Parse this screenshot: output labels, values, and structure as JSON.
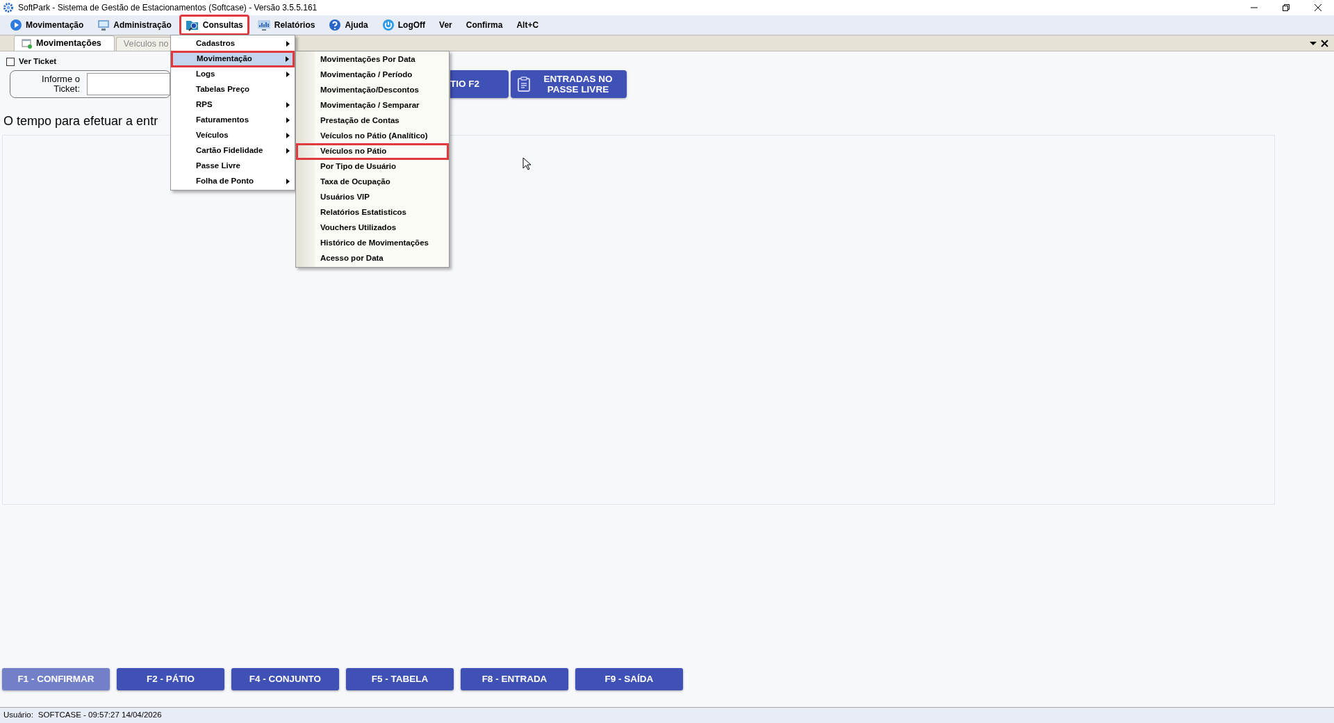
{
  "window": {
    "title": "SoftPark - Sistema de Gestão de Estacionamentos (Softcase) - Versão 3.5.5.161"
  },
  "menu_bar": [
    {
      "label": "Movimentação",
      "open": false,
      "annotated": false
    },
    {
      "label": "Administração",
      "open": false,
      "annotated": false
    },
    {
      "label": "Consultas",
      "open": true,
      "annotated": true
    },
    {
      "label": "Relatórios",
      "open": false,
      "annotated": false
    },
    {
      "label": "Ajuda",
      "open": false,
      "annotated": false
    },
    {
      "label": "LogOff",
      "open": false,
      "annotated": false
    },
    {
      "label": "Ver",
      "open": false,
      "annotated": false
    },
    {
      "label": "Confirma",
      "open": false,
      "annotated": false
    },
    {
      "label": "Alt+C",
      "open": false,
      "annotated": false
    }
  ],
  "tabs": [
    {
      "label": "Movimentações",
      "selected": true
    },
    {
      "label": "Veículos no",
      "selected": false
    }
  ],
  "ver_ticket": {
    "label": "Ver Ticket",
    "checked": false
  },
  "ticket_label": "Informe o Ticket:",
  "top_buttons": [
    {
      "label": "TIO F2",
      "kind": "plain"
    },
    {
      "label": "ENTRADAS NO PASSE LIVRE",
      "kind": "icon"
    }
  ],
  "message": "O tempo para efetuar a entr",
  "function_buttons": [
    {
      "label": "F1 - CONFIRMAR",
      "disabled": true
    },
    {
      "label": "F2 - PÁTIO",
      "disabled": false
    },
    {
      "label": "F4 - CONJUNTO",
      "disabled": false
    },
    {
      "label": "F5 - TABELA",
      "disabled": false
    },
    {
      "label": "F8 - ENTRADA",
      "disabled": false
    },
    {
      "label": "F9 - SAÍDA",
      "disabled": false
    }
  ],
  "status_bar": {
    "label": "Usuário:",
    "value": "SOFTCASE - 09:57:27 14/04/2026"
  },
  "dropdown": {
    "items": [
      {
        "label": "Cadastros",
        "submenu": true,
        "selected": false,
        "annotated": false
      },
      {
        "label": "Movimentação",
        "submenu": true,
        "selected": true,
        "annotated": true
      },
      {
        "label": "Logs",
        "submenu": true,
        "selected": false,
        "annotated": false
      },
      {
        "label": "Tabelas Preço",
        "submenu": false,
        "selected": false,
        "annotated": false
      },
      {
        "label": "RPS",
        "submenu": true,
        "selected": false,
        "annotated": false
      },
      {
        "label": "Faturamentos",
        "submenu": true,
        "selected": false,
        "annotated": false
      },
      {
        "label": "Veículos",
        "submenu": true,
        "selected": false,
        "annotated": false
      },
      {
        "label": "Cartão Fidelidade",
        "submenu": true,
        "selected": false,
        "annotated": false
      },
      {
        "label": "Passe Livre",
        "submenu": false,
        "selected": false,
        "annotated": false
      },
      {
        "label": "Folha de Ponto",
        "submenu": true,
        "selected": false,
        "annotated": false
      }
    ]
  },
  "submenu": {
    "items": [
      {
        "label": "Movimentações Por Data",
        "annotated": false
      },
      {
        "label": "Movimentação / Período",
        "annotated": false
      },
      {
        "label": "Movimentação/Descontos",
        "annotated": false
      },
      {
        "label": "Movimentação / Semparar",
        "annotated": false
      },
      {
        "label": "Prestação de Contas",
        "annotated": false
      },
      {
        "label": "Veículos no Pátio (Analítico)",
        "annotated": false
      },
      {
        "label": "Veículos no Pátio",
        "annotated": true
      },
      {
        "label": "Por Tipo de Usuário",
        "annotated": false
      },
      {
        "label": "Taxa de Ocupação",
        "annotated": false
      },
      {
        "label": "Usuários VIP",
        "annotated": false
      },
      {
        "label": "Relatórios Estatisticos",
        "annotated": false
      },
      {
        "label": "Vouchers Utilizados",
        "annotated": false
      },
      {
        "label": "Histórico de Movimentações",
        "annotated": false
      },
      {
        "label": "Acesso por Data",
        "annotated": false
      }
    ]
  }
}
